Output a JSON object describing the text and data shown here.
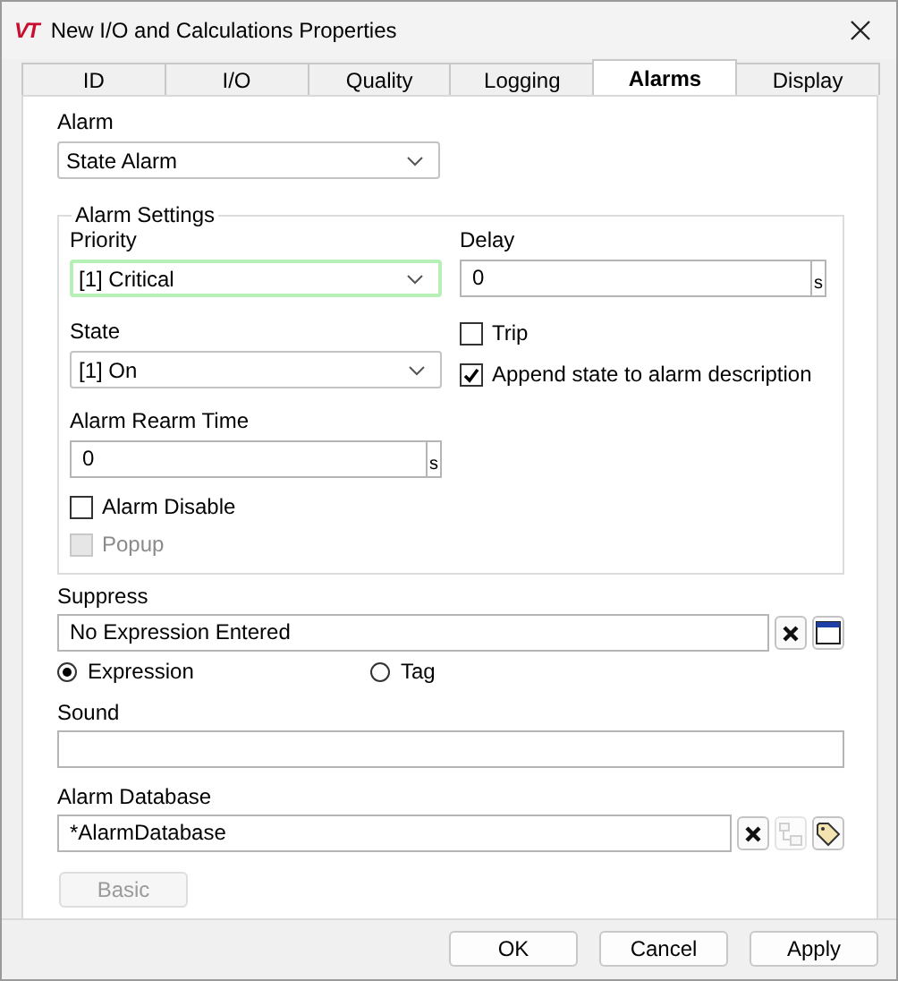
{
  "window": {
    "logo": "VT",
    "title": "New I/O and Calculations Properties"
  },
  "tabs": [
    {
      "label": "ID",
      "selected": false
    },
    {
      "label": "I/O",
      "selected": false
    },
    {
      "label": "Quality",
      "selected": false
    },
    {
      "label": "Logging",
      "selected": false
    },
    {
      "label": "Alarms",
      "selected": true
    },
    {
      "label": "Display",
      "selected": false
    }
  ],
  "alarm": {
    "label": "Alarm",
    "value": "State Alarm"
  },
  "alarm_settings": {
    "title": "Alarm Settings",
    "priority": {
      "label": "Priority",
      "value": "[1] Critical",
      "focused": true
    },
    "state": {
      "label": "State",
      "value": "[1] On",
      "focused": false
    },
    "rearm": {
      "label": "Alarm Rearm Time",
      "value": "0",
      "unit": "s"
    },
    "left_checks": [
      {
        "label": "Alarm Disable",
        "checked": false,
        "disabled": false
      },
      {
        "label": "Popup",
        "checked": false,
        "disabled": true
      }
    ],
    "delay": {
      "label": "Delay",
      "value": "0",
      "unit": "s"
    },
    "right_checks": [
      {
        "label": "Trip",
        "checked": false,
        "disabled": false
      },
      {
        "label": "Append state to alarm description",
        "checked": true,
        "disabled": false
      }
    ]
  },
  "suppress": {
    "label": "Suppress",
    "value": "No Expression Entered",
    "buttons": [
      {
        "kind": "clear",
        "disabled": false
      },
      {
        "kind": "window",
        "disabled": false
      }
    ],
    "options": [
      {
        "label": "Expression",
        "selected": true
      },
      {
        "label": "Tag",
        "selected": false
      }
    ]
  },
  "sound": {
    "label": "Sound"
  },
  "database": {
    "label": "Alarm Database",
    "value": "*AlarmDatabase",
    "buttons": [
      {
        "kind": "clear",
        "disabled": false
      },
      {
        "kind": "tree",
        "disabled": true
      },
      {
        "kind": "tag",
        "disabled": false
      }
    ]
  },
  "basic": {
    "label": "Basic",
    "disabled": true
  },
  "buttons": [
    "OK",
    "Cancel",
    "Apply"
  ]
}
